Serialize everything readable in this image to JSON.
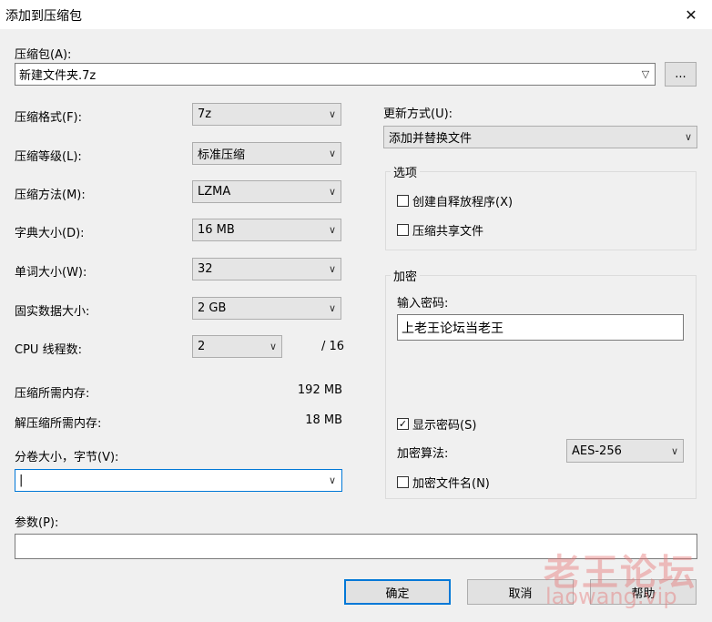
{
  "window": {
    "title": "添加到压缩包",
    "close_glyph": "✕"
  },
  "archive": {
    "label": "压缩包(A):",
    "value": "新建文件夹.7z",
    "browse_label": "..."
  },
  "left": {
    "format": {
      "label": "压缩格式(F):",
      "value": "7z"
    },
    "level": {
      "label": "压缩等级(L):",
      "value": "标准压缩"
    },
    "method": {
      "label": "压缩方法(M):",
      "value": "LZMA"
    },
    "dict": {
      "label": "字典大小(D):",
      "value": "16 MB"
    },
    "word": {
      "label": "单词大小(W):",
      "value": "32"
    },
    "solid": {
      "label": "固实数据大小:",
      "value": "2 GB"
    },
    "threads": {
      "label": "CPU 线程数:",
      "value": "2",
      "max": "/ 16"
    },
    "mem_comp": {
      "label": "压缩所需内存:",
      "value": "192 MB"
    },
    "mem_decomp": {
      "label": "解压缩所需内存:",
      "value": "18 MB"
    },
    "volume": {
      "label": "分卷大小，字节(V):",
      "value": "|"
    }
  },
  "params": {
    "label": "参数(P):",
    "value": ""
  },
  "right": {
    "update": {
      "label": "更新方式(U):",
      "value": "添加并替换文件"
    },
    "options": {
      "title": "选项",
      "sfx": {
        "label": "创建自释放程序(X)",
        "checked": false
      },
      "shared": {
        "label": "压缩共享文件",
        "checked": false
      }
    },
    "encryption": {
      "title": "加密",
      "pwd_label": "输入密码:",
      "pwd_value": "上老王论坛当老王",
      "show_pwd": {
        "label": "显示密码(S)",
        "checked": true,
        "mark": "✓"
      },
      "algo_label": "加密算法:",
      "algo_value": "AES-256",
      "encrypt_names": {
        "label": "加密文件名(N)",
        "checked": false
      }
    }
  },
  "buttons": {
    "ok": "确定",
    "cancel": "取消",
    "help": "帮助"
  },
  "watermark": {
    "cn": "老王论坛",
    "en": "laowang.vip"
  },
  "colors": {
    "focus": "#0078d7",
    "watermark": "#e67878"
  },
  "icons": {
    "dropdown": "chevron-down-icon",
    "close": "close-icon",
    "check": "checkmark-icon"
  }
}
